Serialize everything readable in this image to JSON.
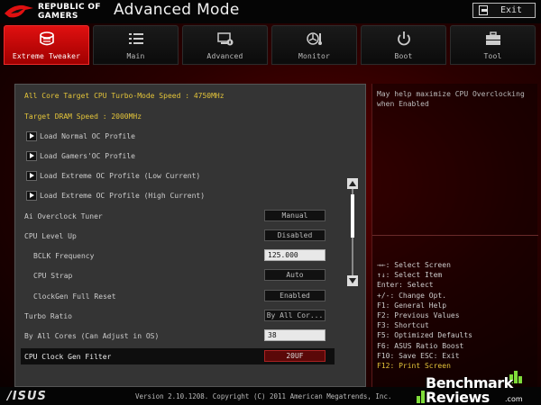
{
  "header": {
    "logo_line1": "REPUBLIC OF",
    "logo_line2": "GAMERS",
    "title": "Advanced Mode",
    "exit_label": "Exit"
  },
  "tabs": [
    {
      "label": "Extreme Tweaker",
      "icon": "extreme-tweaker-icon",
      "active": true
    },
    {
      "label": "Main",
      "icon": "list-icon",
      "active": false
    },
    {
      "label": "Advanced",
      "icon": "advanced-settings-icon",
      "active": false
    },
    {
      "label": "Monitor",
      "icon": "monitor-fan-icon",
      "active": false
    },
    {
      "label": "Boot",
      "icon": "power-icon",
      "active": false
    },
    {
      "label": "Tool",
      "icon": "toolbox-icon",
      "active": false
    }
  ],
  "settings": {
    "cpu_turbo_speed": "All Core Target CPU Turbo-Mode Speed : 4750MHz",
    "dram_speed": "Target DRAM Speed : 2000MHz",
    "profiles": [
      "Load Normal OC Profile",
      "Load Gamers'OC Profile",
      "Load Extreme OC Profile (Low Current)",
      "Load Extreme OC Profile (High Current)"
    ],
    "options": [
      {
        "label": "Ai Overclock Tuner",
        "value": "Manual"
      },
      {
        "label": "CPU Level Up",
        "value": "Disabled"
      },
      {
        "label": "BCLK Frequency",
        "value": "125.000"
      },
      {
        "label": "CPU Strap",
        "value": "Auto"
      },
      {
        "label": "ClockGen Full Reset",
        "value": "Enabled"
      },
      {
        "label": "Turbo Ratio",
        "value": "By All Cor..."
      },
      {
        "label": "By All Cores (Can Adjust in OS)",
        "value": "38"
      },
      {
        "label": "CPU Clock Gen Filter",
        "value": "20UF"
      }
    ]
  },
  "help": {
    "text": "May help maximize CPU Overclocking when Enabled"
  },
  "keys": [
    "→←: Select Screen",
    "↑↓: Select Item",
    "Enter: Select",
    "+/-: Change Opt.",
    "F1: General Help",
    "F2: Previous Values",
    "F3: Shortcut",
    "F5: Optimized Defaults",
    "F6: ASUS Ratio Boost",
    "F10: Save  ESC: Exit",
    "F12: Print Screen"
  ],
  "footer": {
    "brand": "/ISUS",
    "version": "Version 2.10.1208. Copyright (C) 2011 American Megatrends, Inc."
  },
  "watermark": {
    "line1": "Benchmark",
    "line2": "Reviews",
    "suffix": ".com"
  },
  "scroll": {
    "position": 0.12
  }
}
